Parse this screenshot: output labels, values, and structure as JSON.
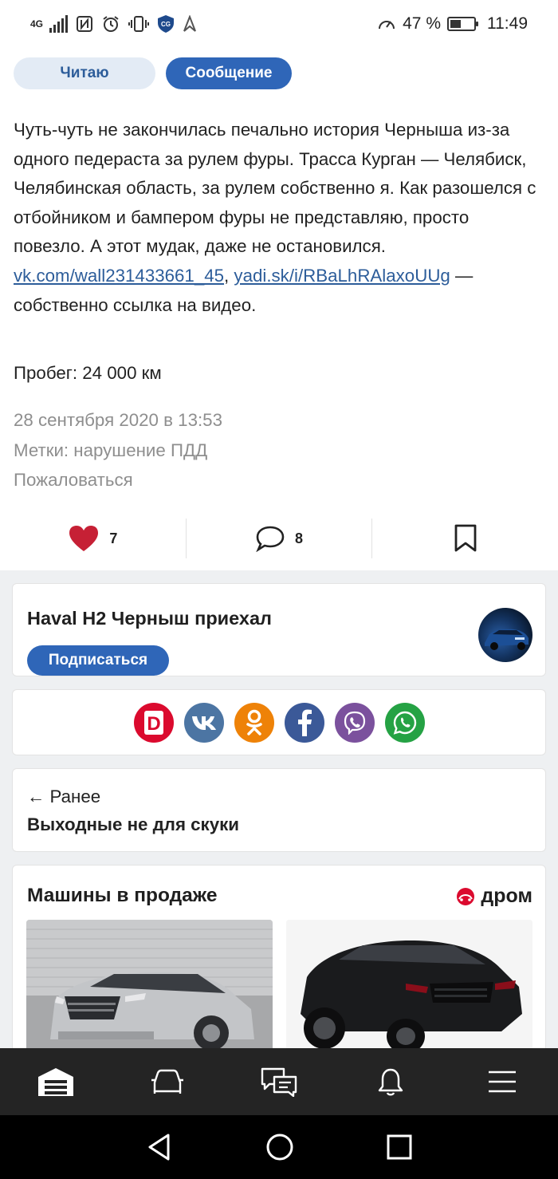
{
  "status_bar": {
    "network": "4G",
    "battery_percent": "47 %",
    "battery_level": 0.47,
    "time": "11:49",
    "icons": [
      "signal-icon",
      "nfc-icon",
      "alarm-icon",
      "vibrate-icon",
      "shield-icon",
      "arrow-icon",
      "speedometer-icon",
      "battery-icon"
    ]
  },
  "actions": {
    "read_label": "Читаю",
    "message_label": "Сообщение"
  },
  "article": {
    "text_before_links": "Чуть-чуть не закончилась печально история Черныша из-за одного педераста за рулем фуры. Трасса Курган — Челябиск, Челябинская область, за рулем собственно я. Как разошелся с отбойником и бампером фуры не представляю, просто повезло. А этот мудак, даже не остановился.",
    "link1": "vk.com/wall231433661_45",
    "separator": ", ",
    "link2": "yadi.sk/i/RBaLhRAlaxoUUg",
    "text_after_links": " — собственно ссылка на видео.",
    "mileage": "Пробег: 24 000 км",
    "date": "28 сентября 2020 в 13:53",
    "tags": "Метки: нарушение ПДД",
    "report": "Пожаловаться"
  },
  "reactions": {
    "likes": "7",
    "comments": "8"
  },
  "author_card": {
    "title": "Haval H2 Черныш приехал",
    "subscribe_label": "Подписаться"
  },
  "share": {
    "networks": [
      "drom",
      "vk",
      "odnoklassniki",
      "facebook",
      "viber",
      "whatsapp"
    ],
    "drom_letter": "D",
    "colors": {
      "drom": "#db0a2e",
      "vk": "#4c75a3",
      "ok": "#ee8208",
      "facebook": "#3b5998",
      "viber": "#7b519d",
      "whatsapp": "#25a244"
    }
  },
  "prev_post": {
    "label": "← Ранее",
    "title": "Выходные не для скуки"
  },
  "sale": {
    "title": "Машины в продаже",
    "brand": "дром"
  },
  "colors": {
    "accent": "#2f66b8",
    "link": "#2d5d9a",
    "like": "#c62035",
    "muted": "#8e8e8e"
  }
}
